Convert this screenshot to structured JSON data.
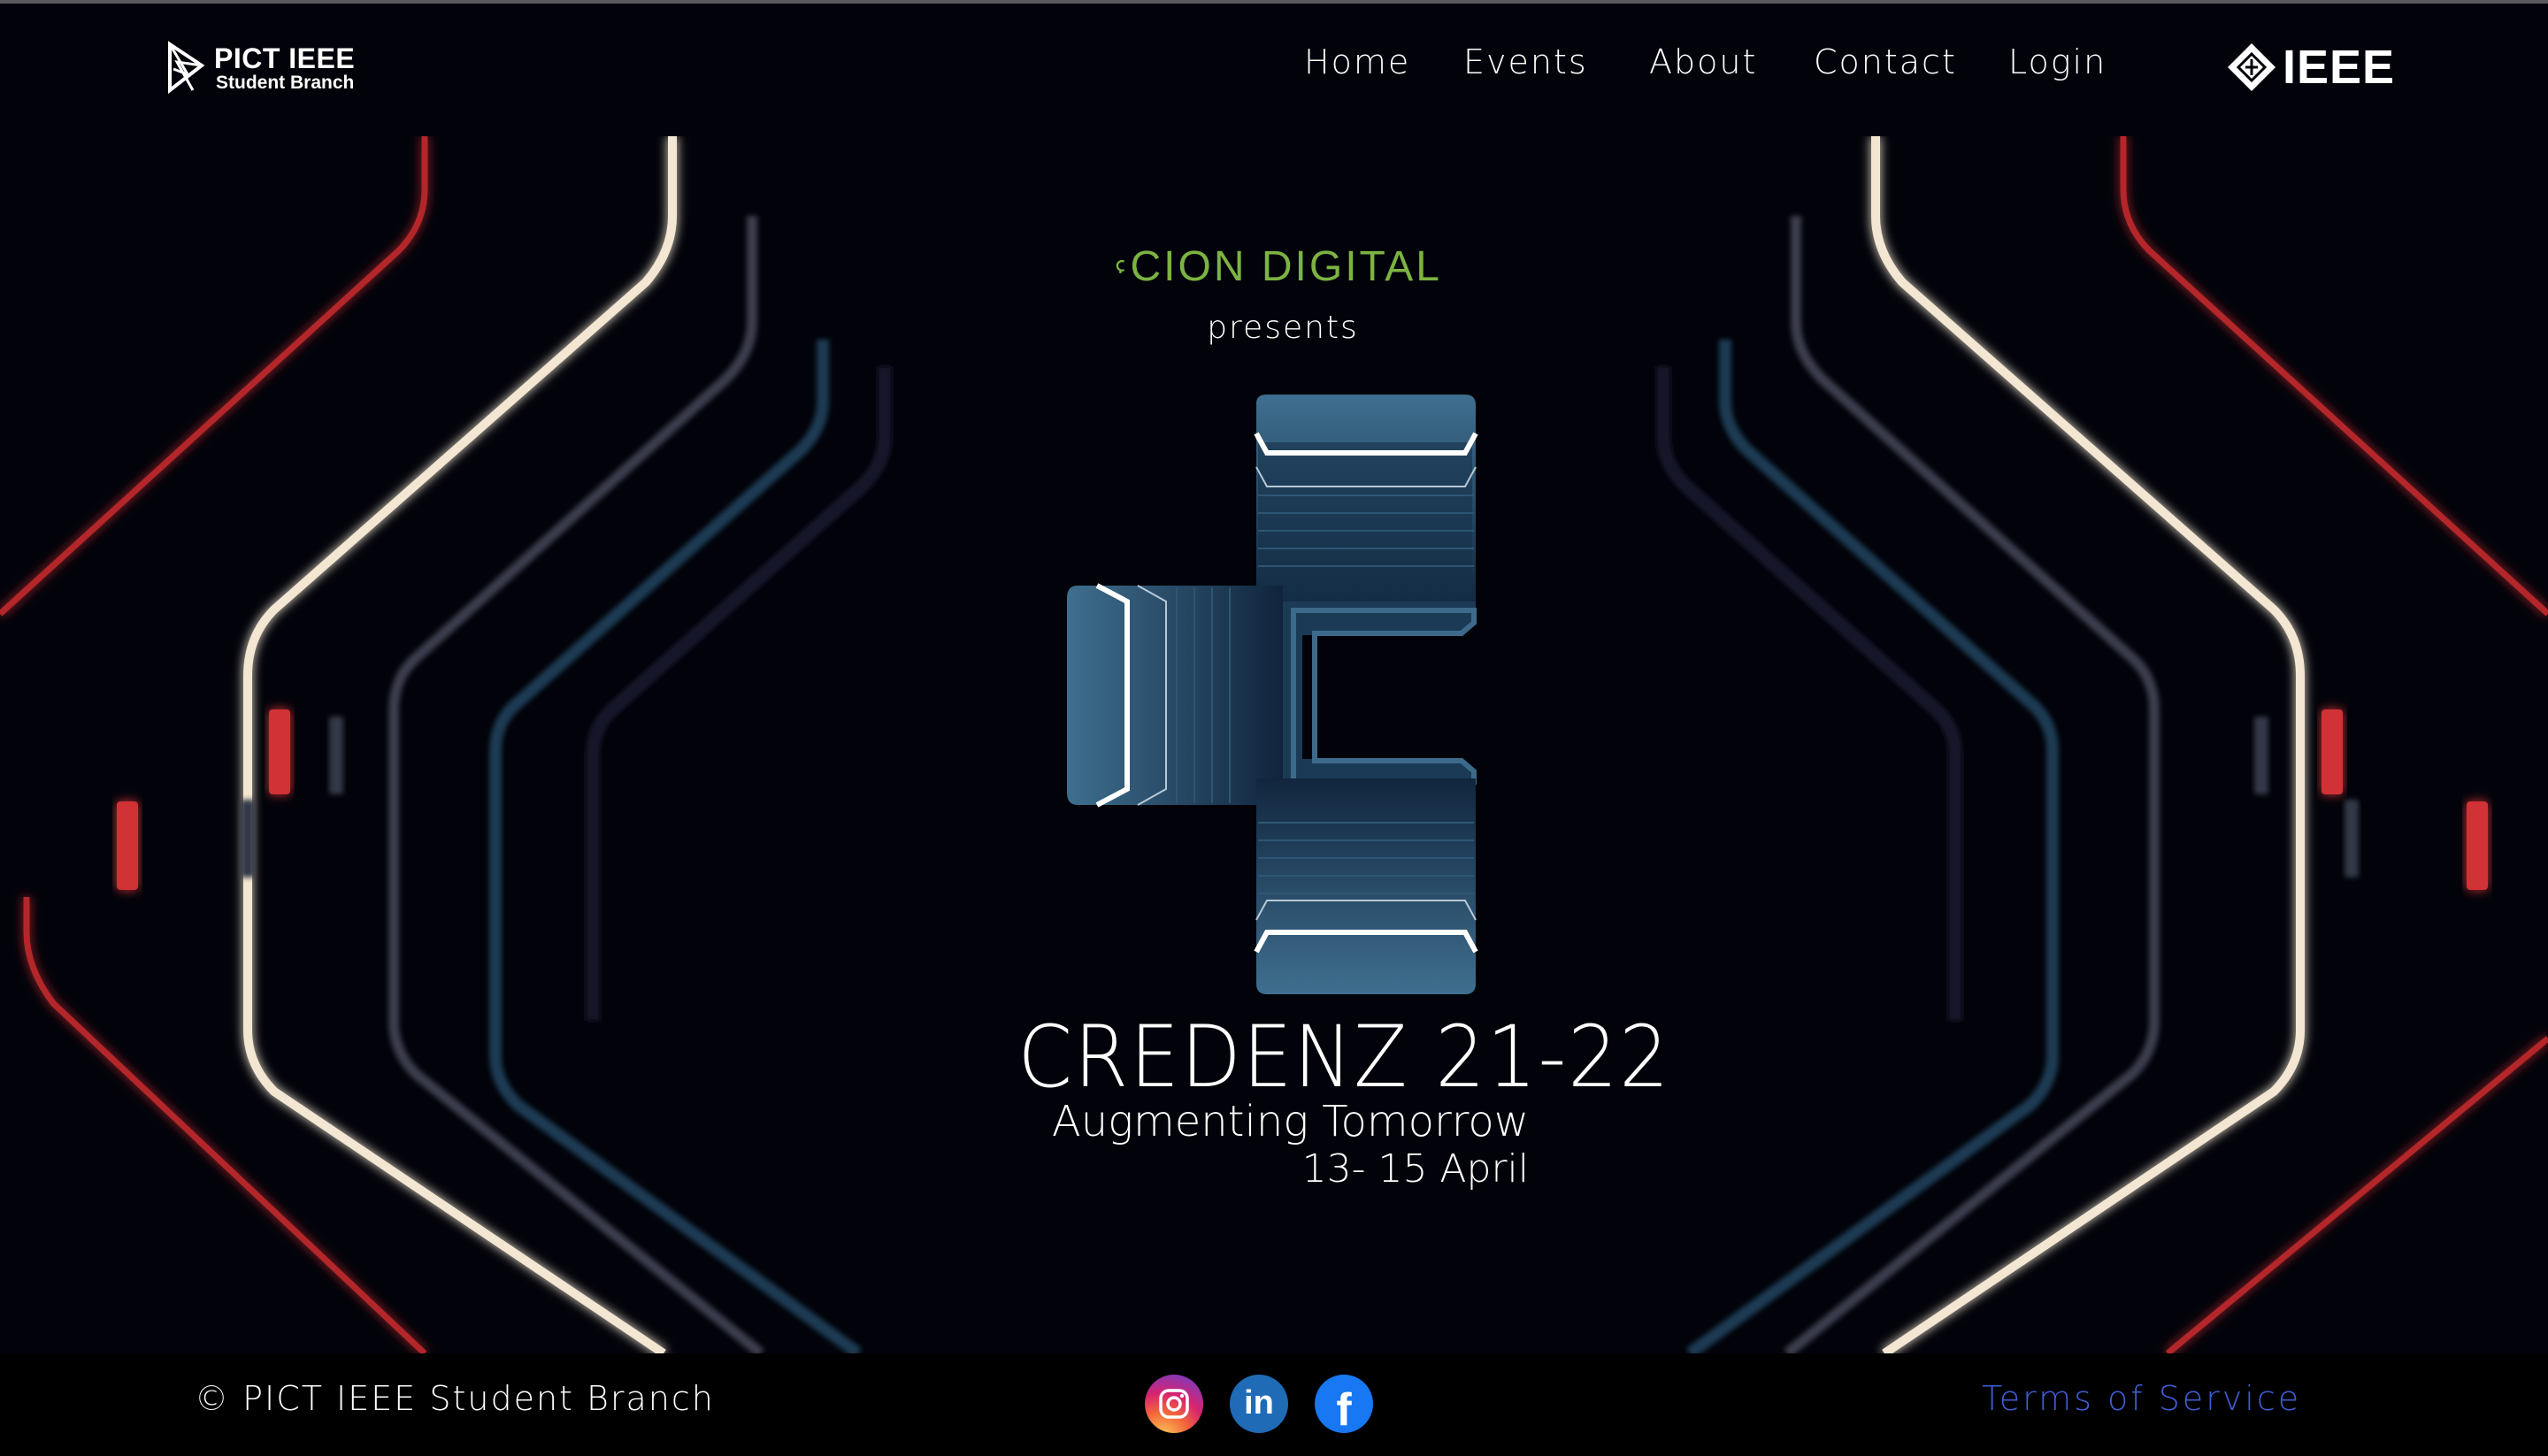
{
  "header": {
    "brand_left_line1": "PICT IEEE",
    "brand_left_line2": "Student Branch",
    "nav": [
      "Home",
      "Events",
      "About",
      "Contact",
      "Login"
    ],
    "brand_right": "IEEE"
  },
  "hero": {
    "sponsor": "CION DIGITAL",
    "presents": "presents",
    "title": "CREDENZ 21-22",
    "tagline": "Augmenting Tomorrow",
    "dates": "13- 15 April"
  },
  "footer": {
    "copyright": "© PICT IEEE Student Branch",
    "social": [
      "instagram-icon",
      "linkedin-icon",
      "facebook-icon"
    ],
    "terms": "Terms of Service"
  },
  "colors": {
    "background": "#02030a",
    "sponsor_green": "#7cb342",
    "logo_blue": "#3d6a8a",
    "terms_link": "#3f5fd6",
    "accent_red": "#c0282b"
  }
}
